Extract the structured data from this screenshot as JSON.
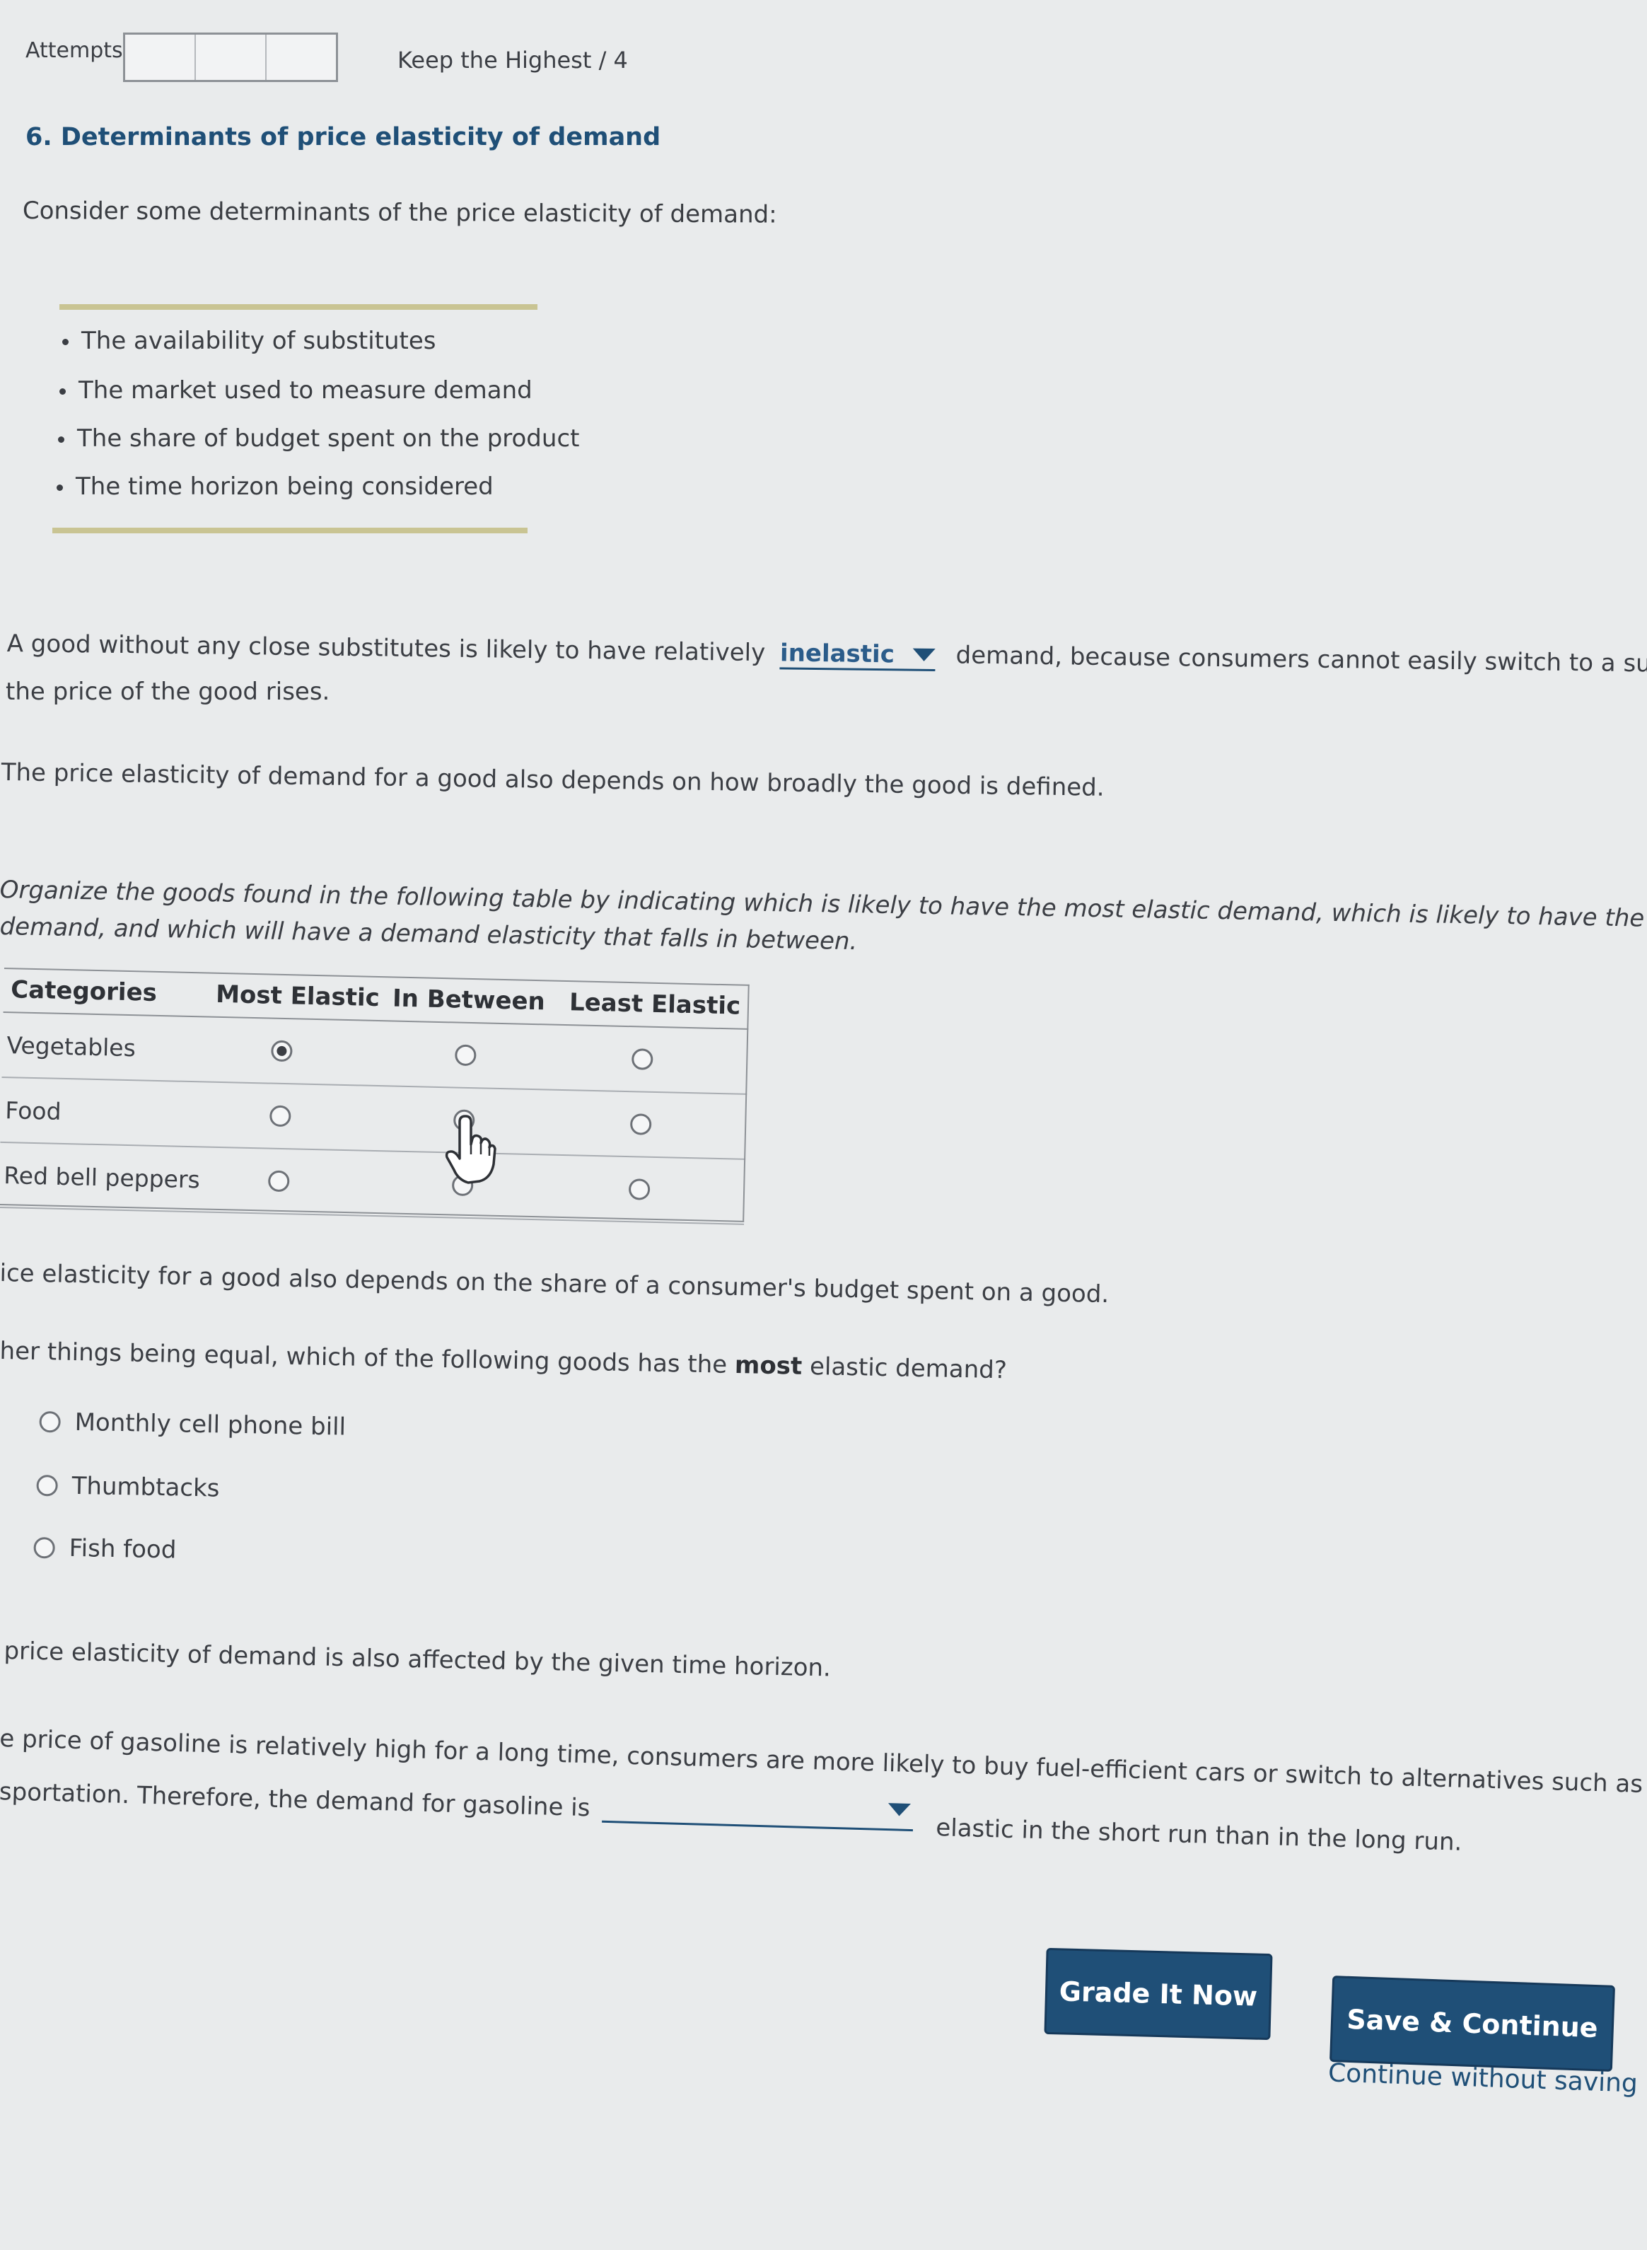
{
  "header": {
    "attempts_label": "Attempts",
    "keep_highest": "Keep the Highest / 4"
  },
  "question": {
    "title": "6. Determinants of price elasticity of demand",
    "intro": "Consider some determinants of the price elasticity of demand:",
    "determinants": [
      "The availability of substitutes",
      "The market used to measure demand",
      "The share of budget spent on the product",
      "The time horizon being considered"
    ]
  },
  "substitutes": {
    "before": "A good without any close substitutes is likely to have relatively",
    "dropdown_value": "inelastic",
    "after": "demand, because consumers cannot easily switch to a substitute go",
    "line2": "the price of the good rises."
  },
  "definition": {
    "text": "The price elasticity of demand for a good also depends on how broadly the good is defined.",
    "instruction_line1": "Organize the goods found in the following table by indicating which is likely to have the most elastic demand, which is likely to have the least elast",
    "instruction_line2": "demand, and which will have a demand elasticity that falls in between."
  },
  "table": {
    "headers": [
      "Categories",
      "Most Elastic",
      "In Between",
      "Least Elastic"
    ],
    "rows": [
      {
        "category": "Vegetables",
        "selected": "Most Elastic"
      },
      {
        "category": "Food",
        "selected": ""
      },
      {
        "category": "Red bell peppers",
        "selected": ""
      }
    ]
  },
  "budget": {
    "text": "ice elasticity for a good also depends on the share of a consumer's budget spent on a good.",
    "question_before": "her things being equal, which of the following goods has the",
    "question_bold": "most",
    "question_after": "elastic demand?",
    "options": [
      "Monthly cell phone bill",
      "Thumbtacks",
      "Fish food"
    ]
  },
  "time_horizon": {
    "text": "price elasticity of demand is also affected by the given time horizon.",
    "line1": "e price of gasoline is relatively high for a long time, consumers are more likely to buy fuel-efficient cars or switch to alternatives such as public",
    "line2_before": "sportation. Therefore, the demand for gasoline is",
    "dropdown_value": "",
    "line2_after": "elastic in the short run than in the long run."
  },
  "actions": {
    "grade_label": "Grade It Now",
    "save_label": "Save & Continue",
    "continue_label": "Continue without saving"
  }
}
